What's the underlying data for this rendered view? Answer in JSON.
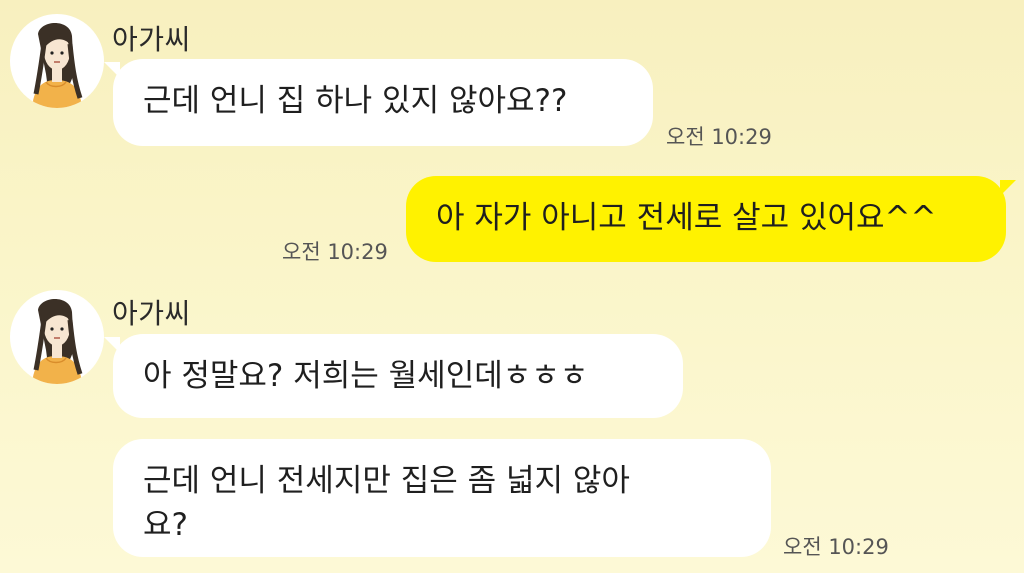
{
  "messages": [
    {
      "sender": "아가씨",
      "text": "근데 언니 집 하나 있지 않아요??",
      "time": "오전 10:29"
    },
    {
      "text": "아 자가 아니고 전세로 살고 있어요^^",
      "time": "오전 10:29"
    },
    {
      "sender": "아가씨",
      "text": "아 정말요? 저희는 월세인데ㅎㅎㅎ"
    },
    {
      "text": "근데 언니 전세지만 집은 좀 넓지 않아\n요?",
      "time": "오전 10:29"
    }
  ],
  "colors": {
    "incoming_bubble": "#ffffff",
    "outgoing_bubble": "#fff200",
    "background": "#f8f0bf"
  },
  "icons": {
    "avatar": "woman-portrait-avatar"
  }
}
